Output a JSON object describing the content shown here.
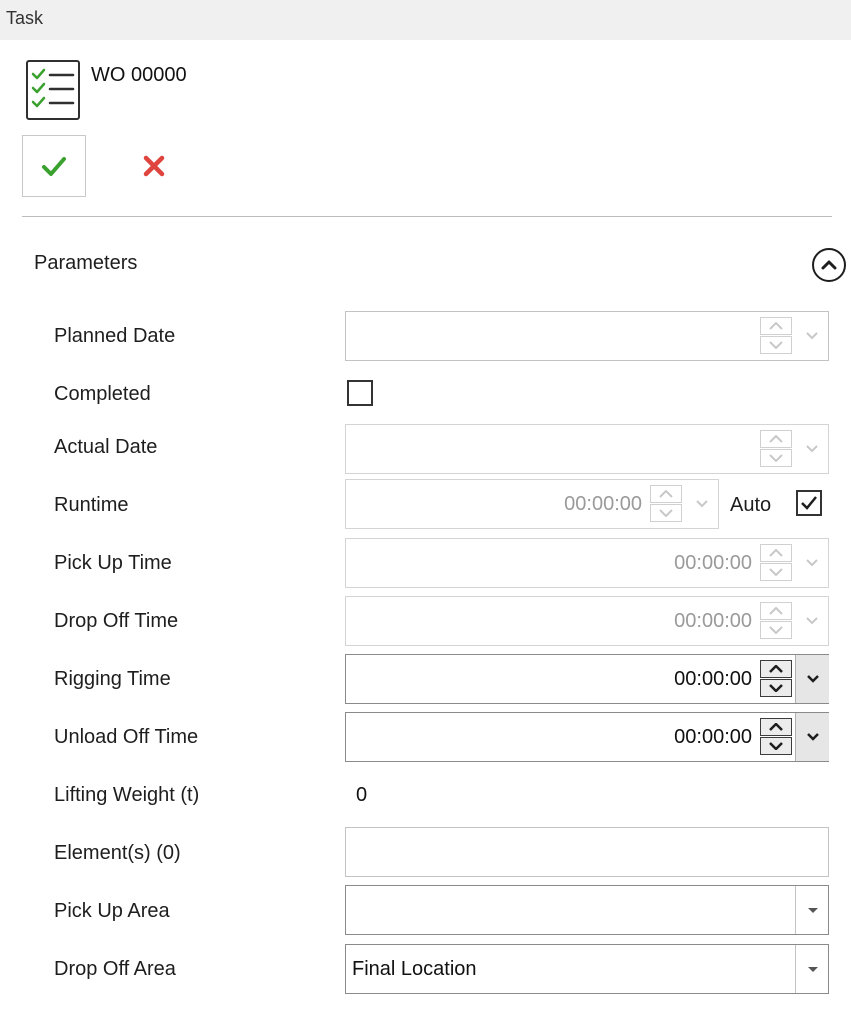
{
  "panel": {
    "title": "Task"
  },
  "task": {
    "name": "WO 00000",
    "icon": "checklist-icon"
  },
  "toolbar": {
    "ok_icon": "checkmark-icon",
    "cancel_icon": "close-icon"
  },
  "section": {
    "title": "Parameters",
    "collapse_icon": "chevron-up-icon"
  },
  "fields": {
    "planned_date": {
      "label": "Planned Date",
      "value": ""
    },
    "completed": {
      "label": "Completed",
      "checked": false
    },
    "actual_date": {
      "label": "Actual Date",
      "value": ""
    },
    "runtime": {
      "label": "Runtime",
      "value": "00:00:00",
      "auto_label": "Auto",
      "auto_checked": true
    },
    "pick_up_time": {
      "label": "Pick Up Time",
      "value": "00:00:00"
    },
    "drop_off_time": {
      "label": "Drop Off Time",
      "value": "00:00:00"
    },
    "rigging_time": {
      "label": "Rigging Time",
      "value": "00:00:00"
    },
    "unload_off_time": {
      "label": "Unload Off Time",
      "value": "00:00:00"
    },
    "lifting_weight": {
      "label": "Lifting Weight (t)",
      "value": "0"
    },
    "elements": {
      "label": "Element(s) (0)",
      "value": ""
    },
    "pick_up_area": {
      "label": "Pick Up Area",
      "value": ""
    },
    "drop_off_area": {
      "label": "Drop Off Area",
      "value": "Final Location"
    }
  },
  "colors": {
    "ok": "#3aa02e",
    "cancel": "#e0443e",
    "header_bg": "#f0f0f0"
  }
}
